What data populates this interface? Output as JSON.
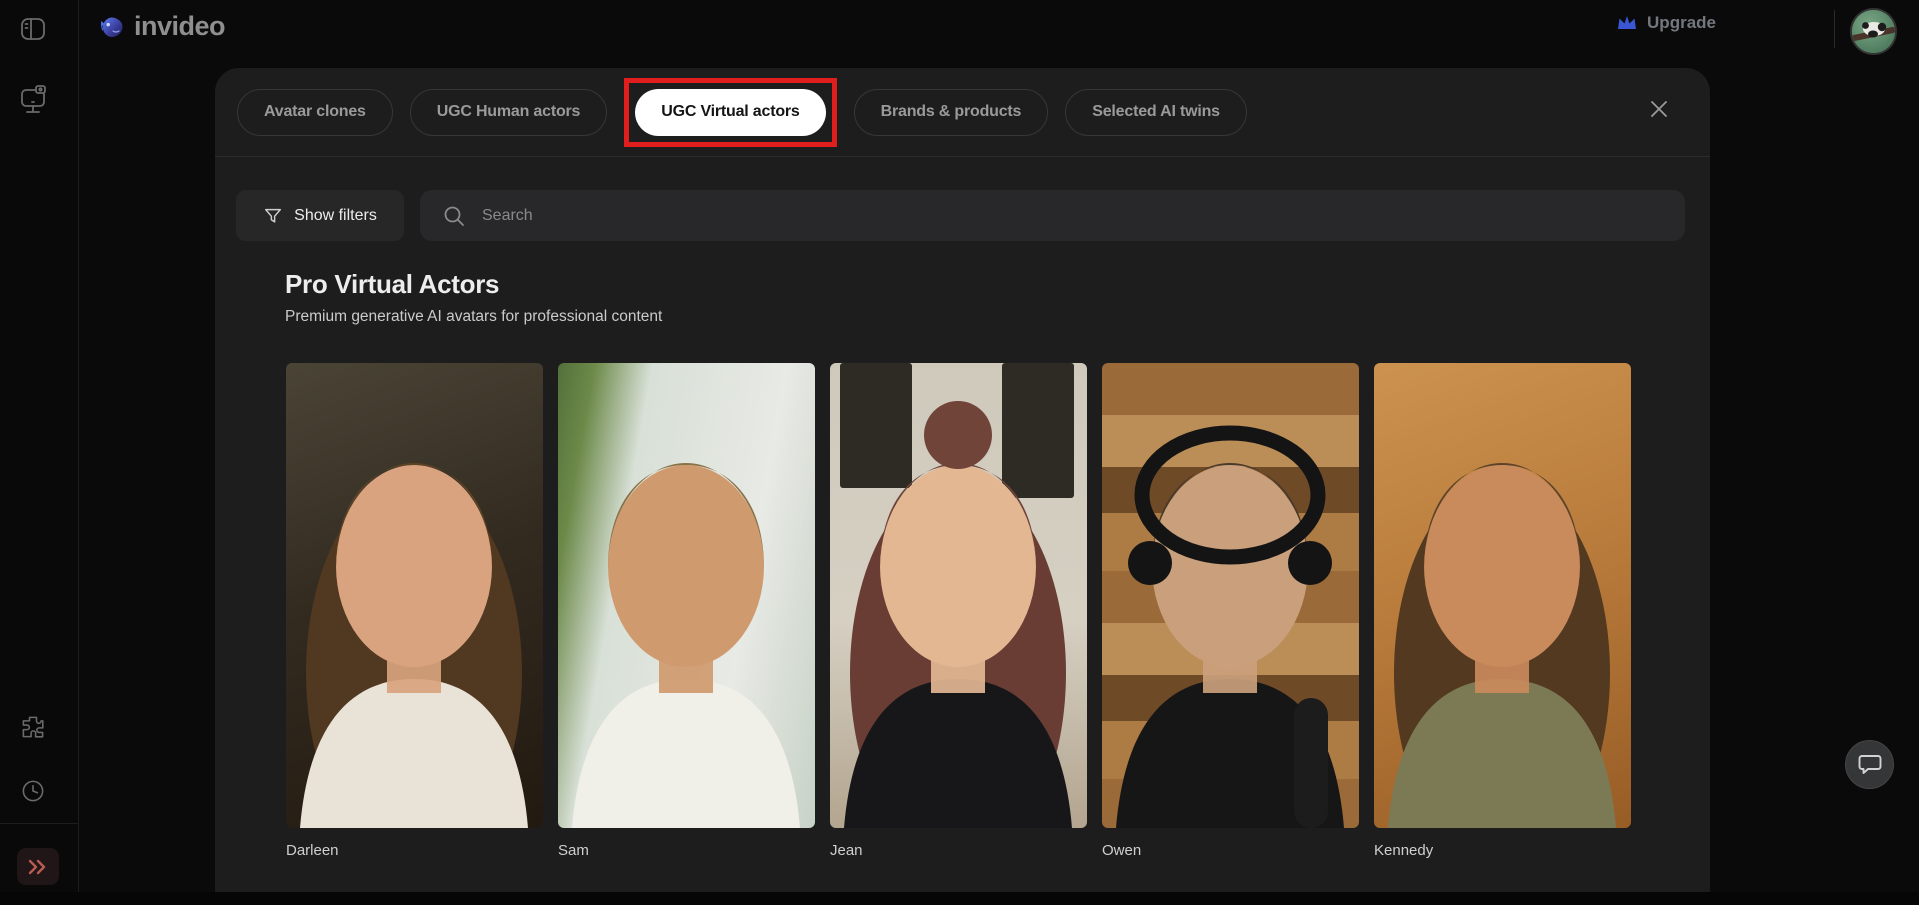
{
  "topbar": {
    "logo_text": "invideo",
    "upgrade_label": "Upgrade"
  },
  "sidebar": {
    "icons": [
      "panel-toggle",
      "screen-studio",
      "plugins",
      "history",
      "expand"
    ]
  },
  "modal": {
    "tabs": [
      {
        "label": "Avatar clones",
        "active": false
      },
      {
        "label": "UGC Human actors",
        "active": false
      },
      {
        "label": "UGC Virtual actors",
        "active": true,
        "highlighted": true
      },
      {
        "label": "Brands & products",
        "active": false
      },
      {
        "label": "Selected AI twins",
        "active": false
      }
    ],
    "filters_button_label": "Show filters",
    "search_placeholder": "Search",
    "section": {
      "title": "Pro Virtual Actors",
      "subtitle": "Premium generative AI avatars for professional content"
    },
    "actors": [
      {
        "name": "Darleen"
      },
      {
        "name": "Sam"
      },
      {
        "name": "Jean"
      },
      {
        "name": "Owen"
      },
      {
        "name": "Kennedy"
      }
    ]
  },
  "colors": {
    "highlight_red": "#e01e1e",
    "upgrade_blue": "#3a56d4",
    "active_tab_bg": "#ffffff",
    "modal_bg": "#1d1d1e",
    "page_bg": "#0a0a0b"
  }
}
